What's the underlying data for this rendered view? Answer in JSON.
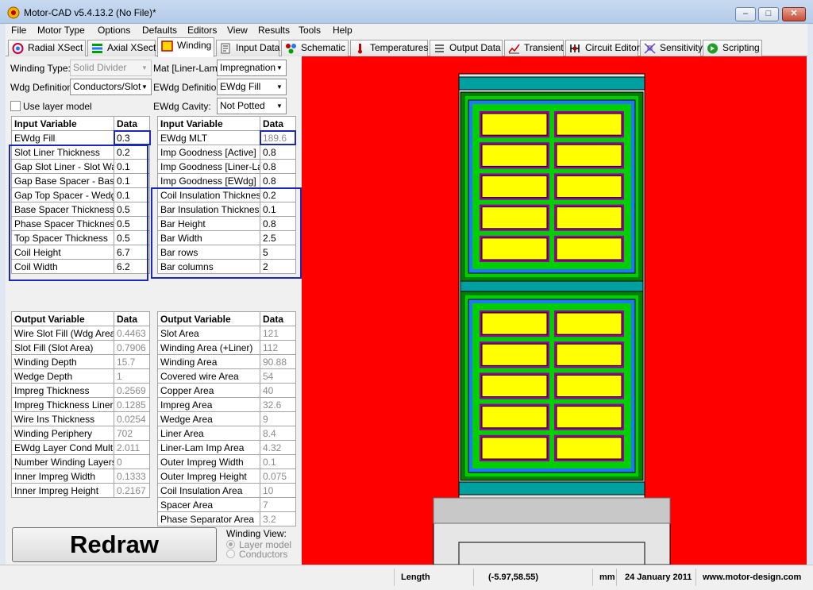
{
  "window": {
    "title": "Motor-CAD v5.4.13.2 (No File)*",
    "minimize": "–",
    "maximize": "□",
    "close": "✕"
  },
  "menu": [
    "File",
    "Motor Type",
    "Options",
    "Defaults",
    "Editors",
    "View",
    "Results",
    "Tools",
    "Help"
  ],
  "tabs": [
    {
      "label": "Radial XSect",
      "icon": "radial-section-icon"
    },
    {
      "label": "Axial XSect",
      "icon": "axial-section-icon"
    },
    {
      "label": "Winding",
      "icon": "winding-icon"
    },
    {
      "label": "Input Data",
      "icon": "input-data-icon"
    },
    {
      "label": "Schematic",
      "icon": "schematic-icon"
    },
    {
      "label": "Temperatures",
      "icon": "thermometer-icon"
    },
    {
      "label": "Output Data",
      "icon": "output-data-icon"
    },
    {
      "label": "Transient",
      "icon": "transient-chart-icon"
    },
    {
      "label": "Circuit Editor",
      "icon": "circuit-editor-icon"
    },
    {
      "label": "Sensitivity",
      "icon": "sensitivity-icon"
    },
    {
      "label": "Scripting",
      "icon": "scripting-icon"
    }
  ],
  "settings": {
    "winding_type_label": "Winding Type:",
    "winding_type_value": "Solid Divider",
    "wdg_definition_label": "Wdg Definition:",
    "wdg_definition_value": "Conductors/Slot",
    "use_layer_model_label": "Use layer model",
    "mat_label": "Mat [Liner-Lam]:",
    "mat_value": "Impregnation",
    "ewdg_definition_label": "EWdg Definition:",
    "ewdg_definition_value": "EWdg Fill",
    "ewdg_cavity_label": "EWdg Cavity:",
    "ewdg_cavity_value": "Not Potted"
  },
  "input_left": {
    "headers": [
      "Input Variable",
      "Data"
    ],
    "rows": [
      [
        "EWdg Fill",
        "0.3"
      ],
      [
        "Slot Liner Thickness",
        "0.2"
      ],
      [
        "Gap Slot Liner - Slot Wall",
        "0.1"
      ],
      [
        "Gap Base Spacer - Base",
        "0.1"
      ],
      [
        "Gap Top Spacer - Wedge",
        "0.1"
      ],
      [
        "Base Spacer Thickness",
        "0.5"
      ],
      [
        "Phase Spacer Thickness",
        "0.5"
      ],
      [
        "Top Spacer Thickness",
        "0.5"
      ],
      [
        "Coil Height",
        "6.7"
      ],
      [
        "Coil Width",
        "6.2"
      ]
    ]
  },
  "input_right": {
    "headers": [
      "Input Variable",
      "Data"
    ],
    "rows": [
      [
        "EWdg MLT",
        "189.6"
      ],
      [
        "Imp Goodness [Active]",
        "0.8"
      ],
      [
        "Imp Goodness [Liner-Lam]",
        "0.8"
      ],
      [
        "Imp Goodness [EWdg]",
        "0.8"
      ],
      [
        "Coil Insulation Thickness",
        "0.2"
      ],
      [
        "Bar Insulation Thickness",
        "0.1"
      ],
      [
        "Bar Height",
        "0.8"
      ],
      [
        "Bar Width",
        "2.5"
      ],
      [
        "Bar rows",
        "5"
      ],
      [
        "Bar columns",
        "2"
      ]
    ]
  },
  "output_left": {
    "headers": [
      "Output Variable",
      "Data"
    ],
    "rows": [
      [
        "Wire Slot Fill (Wdg Area)",
        "0.4463"
      ],
      [
        "Slot Fill (Slot Area)",
        "0.7906"
      ],
      [
        "Winding Depth",
        "15.7"
      ],
      [
        "Wedge Depth",
        "1"
      ],
      [
        "Impreg Thickness",
        "0.2569"
      ],
      [
        "Impreg Thickness Liner",
        "0.1285"
      ],
      [
        "Wire Ins Thickness",
        "0.0254"
      ],
      [
        "Winding Periphery",
        "702"
      ],
      [
        "EWdg Layer Cond Mult",
        "2.011"
      ],
      [
        "Number Winding Layers",
        "0"
      ],
      [
        "Inner Impreg Width",
        "0.1333"
      ],
      [
        "Inner Impreg Height",
        "0.2167"
      ]
    ]
  },
  "output_right": {
    "headers": [
      "Output Variable",
      "Data"
    ],
    "rows": [
      [
        "Slot Area",
        "121"
      ],
      [
        "Winding Area (+Liner)",
        "112"
      ],
      [
        "Winding Area",
        "90.88"
      ],
      [
        "Covered wire Area",
        "54"
      ],
      [
        "Copper Area",
        "40"
      ],
      [
        "Impreg Area",
        "32.6"
      ],
      [
        "Wedge Area",
        "9"
      ],
      [
        "Liner Area",
        "8.4"
      ],
      [
        "Liner-Lam Imp Area",
        "4.32"
      ],
      [
        "Outer Impreg Width",
        "0.1"
      ],
      [
        "Outer Impreg Height",
        "0.075"
      ],
      [
        "Coil Insulation Area",
        "10"
      ],
      [
        "Spacer Area",
        "7"
      ],
      [
        "Phase Separator Area",
        "3.2"
      ]
    ]
  },
  "redraw_label": "Redraw",
  "winding_view": {
    "label": "Winding View:",
    "options": [
      "Layer model",
      "Conductors"
    ],
    "selected": "Layer model"
  },
  "status": {
    "label": "Length",
    "coords": "(-5.97,58.55)",
    "unit": "mm",
    "date": "24 January 2011",
    "website": "www.motor-design.com"
  },
  "colors": {
    "lamination": "#ff0000",
    "slot_background": "#e6e6e6",
    "wedge": "#00a0a0",
    "liner": "#008000",
    "impregnation": "#00d000",
    "coil_insulation": "#1e78ff",
    "bar_insulation": "#a000a0",
    "conductor": "#ffff00",
    "highlight": "#1c29b8"
  }
}
